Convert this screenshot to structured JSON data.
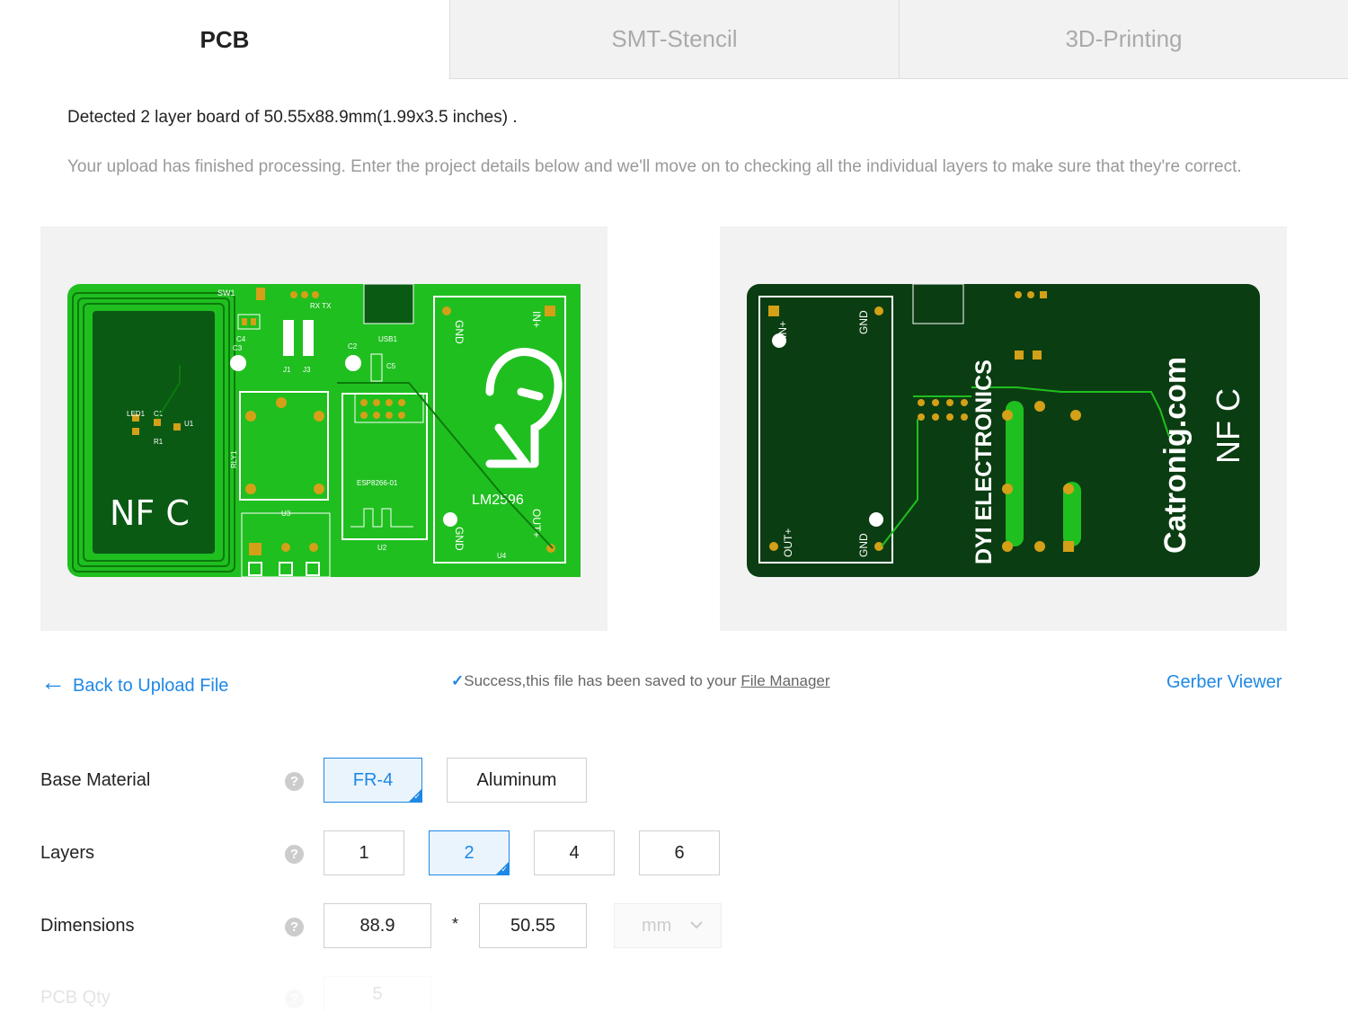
{
  "tabs": [
    {
      "label": "PCB",
      "active": true
    },
    {
      "label": "SMT-Stencil",
      "active": false
    },
    {
      "label": "3D-Printing",
      "active": false
    }
  ],
  "detected_text": "Detected 2 layer board of 50.55x88.9mm(1.99x3.5 inches) .",
  "description": "Your upload has finished processing. Enter the project details below and we'll move on to checking all the individual layers to make sure that they're correct.",
  "preview_top": {
    "labels": {
      "sw": "SW1",
      "nfc": "NF C",
      "led": "LED1",
      "c1": "C1",
      "r1": "R1",
      "u1": "U1",
      "c3": "C3",
      "c4": "C4",
      "c2": "C2",
      "c5": "C5",
      "j1": "J1",
      "j3": "J3",
      "usb": "USB1",
      "rly": "RLY1",
      "esp": "ESP8266-01",
      "u2": "U2",
      "u3": "U3",
      "lm": "LM2596",
      "u4": "U4",
      "gnd": "GND",
      "in": "IN+",
      "out": "OUT+",
      "rxtx": "RX TX"
    }
  },
  "preview_bottom": {
    "labels": {
      "in": "IN+",
      "gnd": "GND",
      "out": "OUT+",
      "brand": "DYI ELECTRONICS",
      "site": "Catronig.com",
      "nfc": "NF C"
    }
  },
  "back_link": "Back to Upload File",
  "success": {
    "text": "Success,this file has been saved to your ",
    "link": "File Manager"
  },
  "gerber_viewer": "Gerber Viewer",
  "form": {
    "base_material": {
      "label": "Base Material",
      "options": [
        "FR-4",
        "Aluminum"
      ],
      "selected": "FR-4"
    },
    "layers": {
      "label": "Layers",
      "options": [
        "1",
        "2",
        "4",
        "6"
      ],
      "selected": "2"
    },
    "dimensions": {
      "label": "Dimensions",
      "width": "88.9",
      "height": "50.55",
      "separator": "*",
      "unit": "mm"
    },
    "pcb_qty": {
      "label": "PCB Qty",
      "value": "5"
    }
  },
  "colors": {
    "accent": "#1e88e5",
    "pcb_top": "#1fbf1f",
    "pcb_bottom": "#0b3d12",
    "pad": "#d4a017"
  }
}
